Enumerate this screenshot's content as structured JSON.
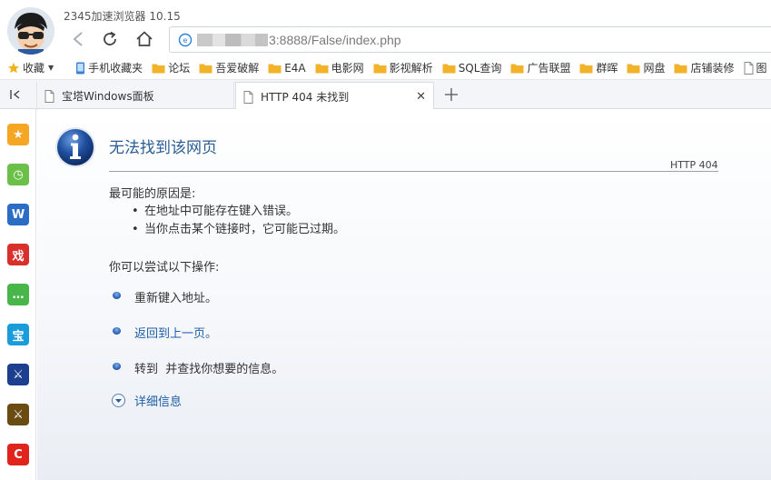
{
  "app": {
    "title": "2345加速浏览器 10.15"
  },
  "address": {
    "url": "3:8888/False/index.php"
  },
  "bookmarks": {
    "items": [
      {
        "label": "收藏",
        "icon": "star-icon"
      },
      {
        "label": "手机收藏夹",
        "icon": "phone-icon"
      },
      {
        "label": "论坛",
        "icon": "folder-icon"
      },
      {
        "label": "吾爱破解",
        "icon": "folder-icon"
      },
      {
        "label": "E4A",
        "icon": "folder-icon"
      },
      {
        "label": "电影网",
        "icon": "folder-icon"
      },
      {
        "label": "影视解析",
        "icon": "folder-icon"
      },
      {
        "label": "SQL查询",
        "icon": "folder-icon"
      },
      {
        "label": "广告联盟",
        "icon": "folder-icon"
      },
      {
        "label": "群晖",
        "icon": "folder-icon"
      },
      {
        "label": "网盘",
        "icon": "folder-icon"
      },
      {
        "label": "店铺装修",
        "icon": "folder-icon"
      },
      {
        "label": "图",
        "icon": "page-icon"
      }
    ]
  },
  "tabs": [
    {
      "label": "宝塔Windows面板",
      "active": false
    },
    {
      "label": "HTTP 404 未找到",
      "active": true
    }
  ],
  "sidebar": {
    "apps": [
      {
        "name": "favorites-app",
        "color": "#f5a623",
        "glyph": "★"
      },
      {
        "name": "clock-app",
        "color": "#6cc04a",
        "glyph": "◷"
      },
      {
        "name": "word-app",
        "color": "#2b6cc4",
        "glyph": "W"
      },
      {
        "name": "game-app",
        "color": "#d9302c",
        "glyph": "戏"
      },
      {
        "name": "wechat-app",
        "color": "#48b648",
        "glyph": "…"
      },
      {
        "name": "baota-app",
        "color": "#1a9bdb",
        "glyph": "宝"
      },
      {
        "name": "sword-game-app",
        "color": "#1d3f8f",
        "glyph": "⚔"
      },
      {
        "name": "legend-game-app",
        "color": "#6a4b12",
        "glyph": "⚔"
      },
      {
        "name": "red-app",
        "color": "#e0241b",
        "glyph": "C"
      }
    ]
  },
  "error_page": {
    "title": "无法找到该网页",
    "code": "HTTP 404",
    "causes_heading": "最可能的原因是:",
    "causes": [
      "在地址中可能存在键入错误。",
      "当你点击某个链接时，它可能已过期。"
    ],
    "try_heading": "你可以尝试以下操作:",
    "actions": [
      {
        "text": "重新键入地址。",
        "is_link": false
      },
      {
        "text": "返回到上一页。",
        "is_link": true
      },
      {
        "text": "转到  并查找你想要的信息。",
        "is_link": false
      }
    ],
    "details_label": "详细信息"
  }
}
